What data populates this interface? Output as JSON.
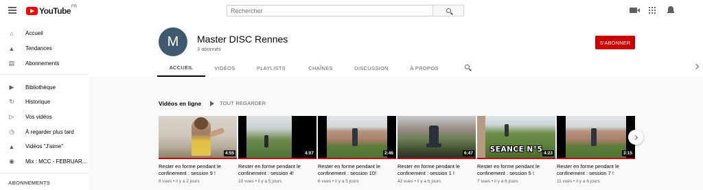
{
  "masthead": {
    "logo_text": "YouTube",
    "country": "FR",
    "search_placeholder": "Rechercher"
  },
  "sidebar": {
    "items": [
      {
        "label": "Accueil",
        "icon": "home-icon"
      },
      {
        "label": "Tendances",
        "icon": "flame-icon"
      },
      {
        "label": "Abonnements",
        "icon": "subscriptions-icon"
      },
      {
        "label": "Bibliothèque",
        "icon": "library-icon"
      },
      {
        "label": "Historique",
        "icon": "history-icon"
      },
      {
        "label": "Vos vidéos",
        "icon": "your-videos-icon"
      },
      {
        "label": "À regarder plus tard",
        "icon": "watch-later-icon"
      },
      {
        "label": "Vidéos \"J'aime\"",
        "icon": "thumbs-up-icon"
      },
      {
        "label": "Mix : MCC - FEBRUAR...",
        "icon": "mix-icon"
      }
    ],
    "section_title": "ABONNEMENTS"
  },
  "channel": {
    "avatar_letter": "M",
    "name": "Master DISC Rennes",
    "subscribers": "3 abonnés",
    "subscribe_label": "S'ABONNER",
    "tabs": [
      "ACCUEIL",
      "VIDÉOS",
      "PLAYLISTS",
      "CHAÎNES",
      "DISCUSSION",
      "À PROPOS"
    ],
    "active_tab": "ACCUEIL"
  },
  "shelf": {
    "title": "Vidéos en ligne",
    "play_all": "TOUT REGARDER",
    "videos": [
      {
        "title": "Rester en forme pendant le confinement : session 9 !",
        "meta": "8 vues • il y a 2 jours",
        "duration": "4:55"
      },
      {
        "title": "Rester en forme pendant le confinement : session 4!",
        "meta": "10 vues • il y a 5 jours",
        "duration": "4:07"
      },
      {
        "title": "Rester en forme pendant le confinement : session 10!",
        "meta": "6 vues • il y a 5 jours",
        "duration": "2:46"
      },
      {
        "title": "Rester en forme pendant le confinement : session 1 !",
        "meta": "42 vues • il y a 6 jours",
        "duration": "6:47"
      },
      {
        "title": "Rester en forme pendant le confinement : session 5 !",
        "meta": "7 vues • il y a 6 jours",
        "duration": "4:23",
        "overlay": "SEANCE N°5"
      },
      {
        "title": "Rester en forme pendant le confinement : session 7 !",
        "meta": "11 vues • il y a 6 jours",
        "duration": "3:15"
      }
    ]
  }
}
